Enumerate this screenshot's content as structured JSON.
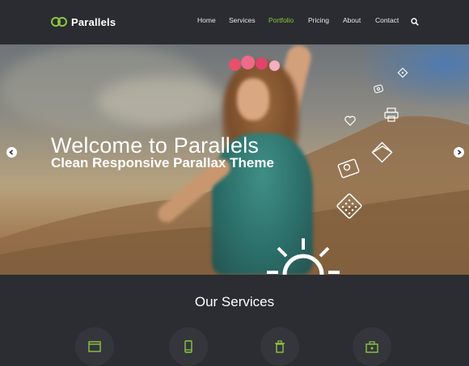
{
  "brand": {
    "name": "Parallels",
    "accent": "#8cc63f"
  },
  "nav": {
    "items": [
      {
        "label": "Home",
        "active": false
      },
      {
        "label": "Services",
        "active": false
      },
      {
        "label": "Portfolio",
        "active": true
      },
      {
        "label": "Pricing",
        "active": false
      },
      {
        "label": "About",
        "active": false
      },
      {
        "label": "Contact",
        "active": false
      }
    ],
    "search_icon": "search-icon"
  },
  "hero": {
    "title": "Welcome to Parallels",
    "subtitle": "Clean Responsive Parallax Theme",
    "prev_icon": "arrow-left-icon",
    "next_icon": "arrow-right-icon",
    "decor_icons": [
      "tag-icon",
      "eye-icon",
      "printer-icon",
      "heart-icon",
      "envelope-icon",
      "location-icon",
      "calculator-icon",
      "sun-icon"
    ]
  },
  "services": {
    "title": "Our Services",
    "icons": [
      "browser-icon",
      "mobile-icon",
      "trash-icon",
      "briefcase-icon"
    ]
  }
}
